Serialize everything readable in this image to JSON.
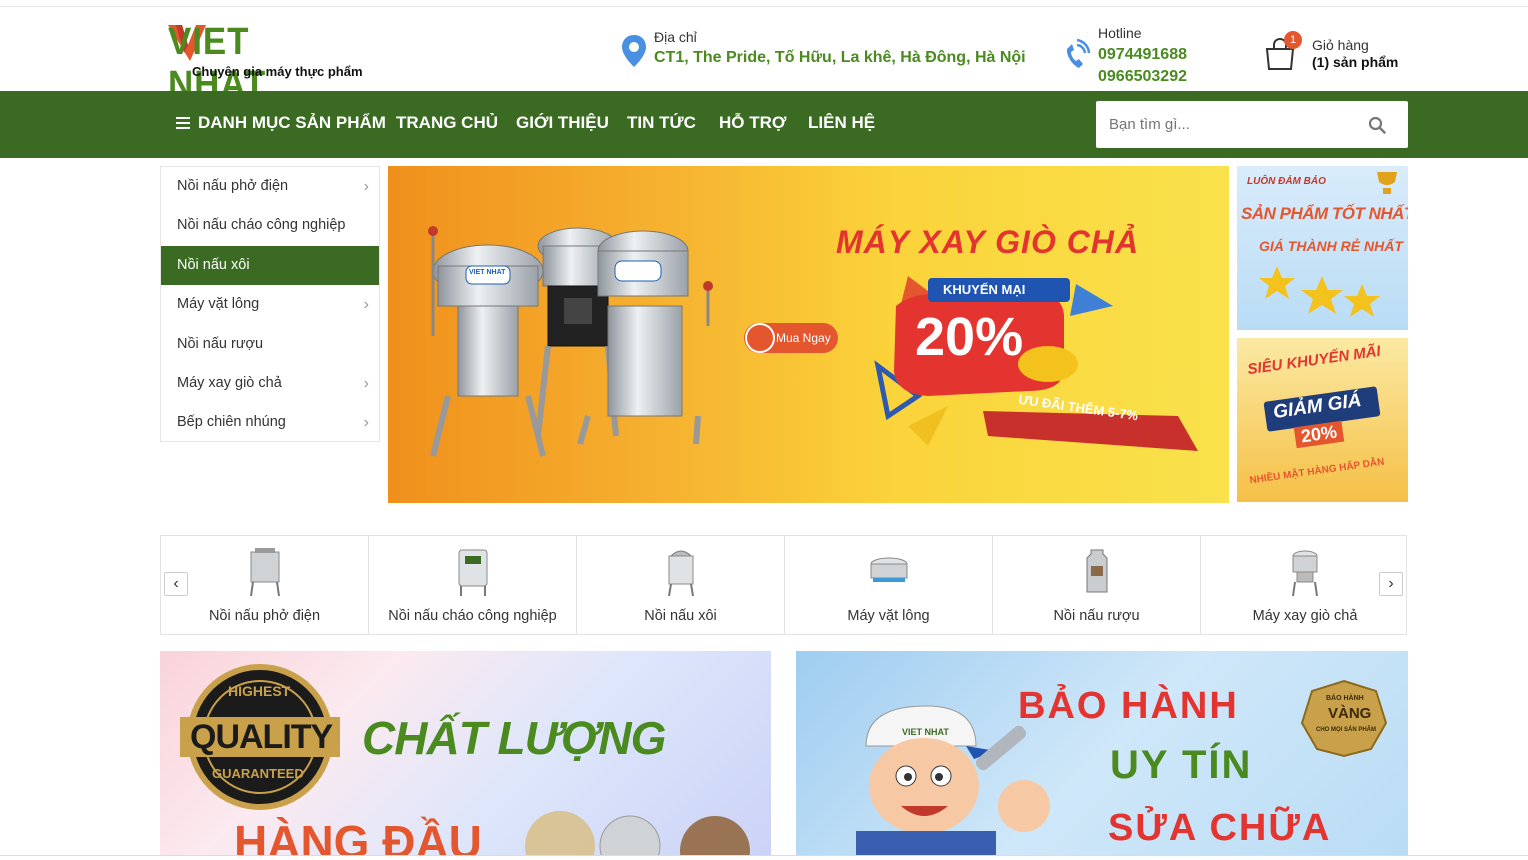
{
  "brand": {
    "logo_text": "VIET NHAT",
    "tagline": "Chuyên gia máy thực phẩm"
  },
  "address": {
    "label": "Địa chỉ",
    "value": "CT1, The Pride, Tố Hữu, La khê, Hà Đông, Hà Nội"
  },
  "hotline": {
    "label": "Hotline",
    "phone1": "0974491688",
    "phone2": "0966503292"
  },
  "cart": {
    "count": "1",
    "label": "Giỏ hàng",
    "value": "(1) sản phẩm"
  },
  "nav": {
    "category_menu": "DANH MỤC SẢN PHẨM",
    "items": [
      "TRANG CHỦ",
      "GIỚI THIỆU",
      "TIN TỨC",
      "HỖ TRỢ",
      "LIÊN HỆ"
    ]
  },
  "search": {
    "placeholder": "Bạn tìm gì..."
  },
  "side_menu": [
    {
      "label": "Nồi nấu phở điện",
      "has_sub": true
    },
    {
      "label": "Nồi nấu cháo công nghiệp",
      "has_sub": false
    },
    {
      "label": "Nồi nấu xôi",
      "has_sub": false,
      "active": true
    },
    {
      "label": "Máy vặt lông",
      "has_sub": true
    },
    {
      "label": "Nồi nấu rượu",
      "has_sub": false
    },
    {
      "label": "Máy xay giò chả",
      "has_sub": true
    },
    {
      "label": "Bếp chiên nhúng",
      "has_sub": true
    }
  ],
  "main_banner": {
    "title": "MÁY XAY GIÒ CHẢ",
    "badge": "KHUYẾN MẠI",
    "discount": "20%",
    "ribbon": "ƯU ĐÃI THÊM 5-7%",
    "cta": "Mua Ngay",
    "machine_label": "VIET NHAT"
  },
  "side_banner_1": {
    "line1": "LUÔN ĐẢM BẢO",
    "line2": "SẢN PHẨM TỐT NHẤT",
    "line3": "GIÁ THÀNH RẺ NHẤT"
  },
  "side_banner_2": {
    "line1": "SIÊU KHUYẾN MÃI",
    "line2": "GIẢM GIÁ",
    "line3": "20%",
    "line4": "NHIỀU MẶT HÀNG HẤP DẪN"
  },
  "categories": [
    {
      "label": "Nồi nấu phở điện",
      "icon": "pho-pot-icon"
    },
    {
      "label": "Nồi nấu cháo công nghiệp",
      "icon": "porridge-pot-icon"
    },
    {
      "label": "Nồi nấu xôi",
      "icon": "rice-steamer-icon"
    },
    {
      "label": "Máy vặt lông",
      "icon": "plucker-icon"
    },
    {
      "label": "Nồi nấu rượu",
      "icon": "distiller-icon"
    },
    {
      "label": "Máy xay giò chả",
      "icon": "grinder-icon"
    }
  ],
  "promo_quality": {
    "seal_top": "HIGHEST",
    "seal_mid": "QUALITY",
    "seal_bot": "GUARANTEED",
    "line1": "CHẤT LƯỢNG",
    "line2": "HÀNG ĐẦU"
  },
  "promo_warranty": {
    "line1": "BẢO HÀNH",
    "line2": "UY TÍN",
    "line3": "SỬA CHỮA",
    "seal_top": "BẢO HÀNH",
    "seal_mid": "VÀNG",
    "seal_bot": "CHO MỌI SẢN PHẨM",
    "cap_text": "VIET NHAT"
  },
  "colors": {
    "brand_green": "#3b6b22",
    "accent_green": "#4a8a1f",
    "accent_red": "#e4572e"
  }
}
